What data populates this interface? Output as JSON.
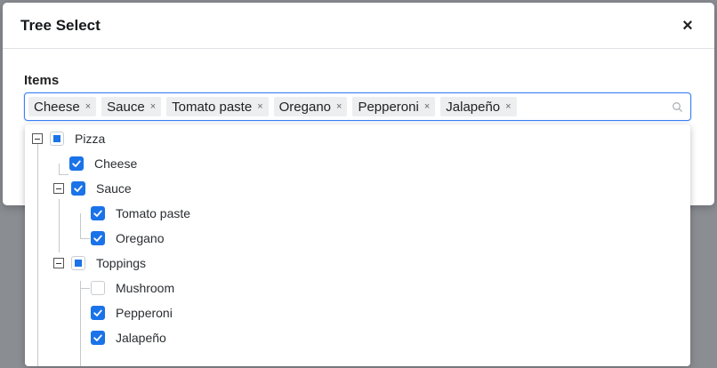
{
  "dialog": {
    "title": "Tree Select",
    "close_symbol": "×"
  },
  "field": {
    "label": "Items",
    "remove_symbol": "×"
  },
  "tags": [
    "Cheese",
    "Sauce",
    "Tomato paste",
    "Oregano",
    "Pepperoni",
    "Jalapeño"
  ],
  "tree": [
    {
      "label": "Pizza",
      "state": "partial",
      "expanded": true
    },
    {
      "label": "Cheese",
      "state": "checked"
    },
    {
      "label": "Sauce",
      "state": "checked",
      "expanded": true
    },
    {
      "label": "Tomato paste",
      "state": "checked"
    },
    {
      "label": "Oregano",
      "state": "checked"
    },
    {
      "label": "Toppings",
      "state": "partial",
      "expanded": true
    },
    {
      "label": "Mushroom",
      "state": "unchecked"
    },
    {
      "label": "Pepperoni",
      "state": "checked"
    },
    {
      "label": "Jalapeño",
      "state": "checked"
    }
  ],
  "colors": {
    "accent": "#1a73e8",
    "focus_border": "#3b82f6"
  }
}
